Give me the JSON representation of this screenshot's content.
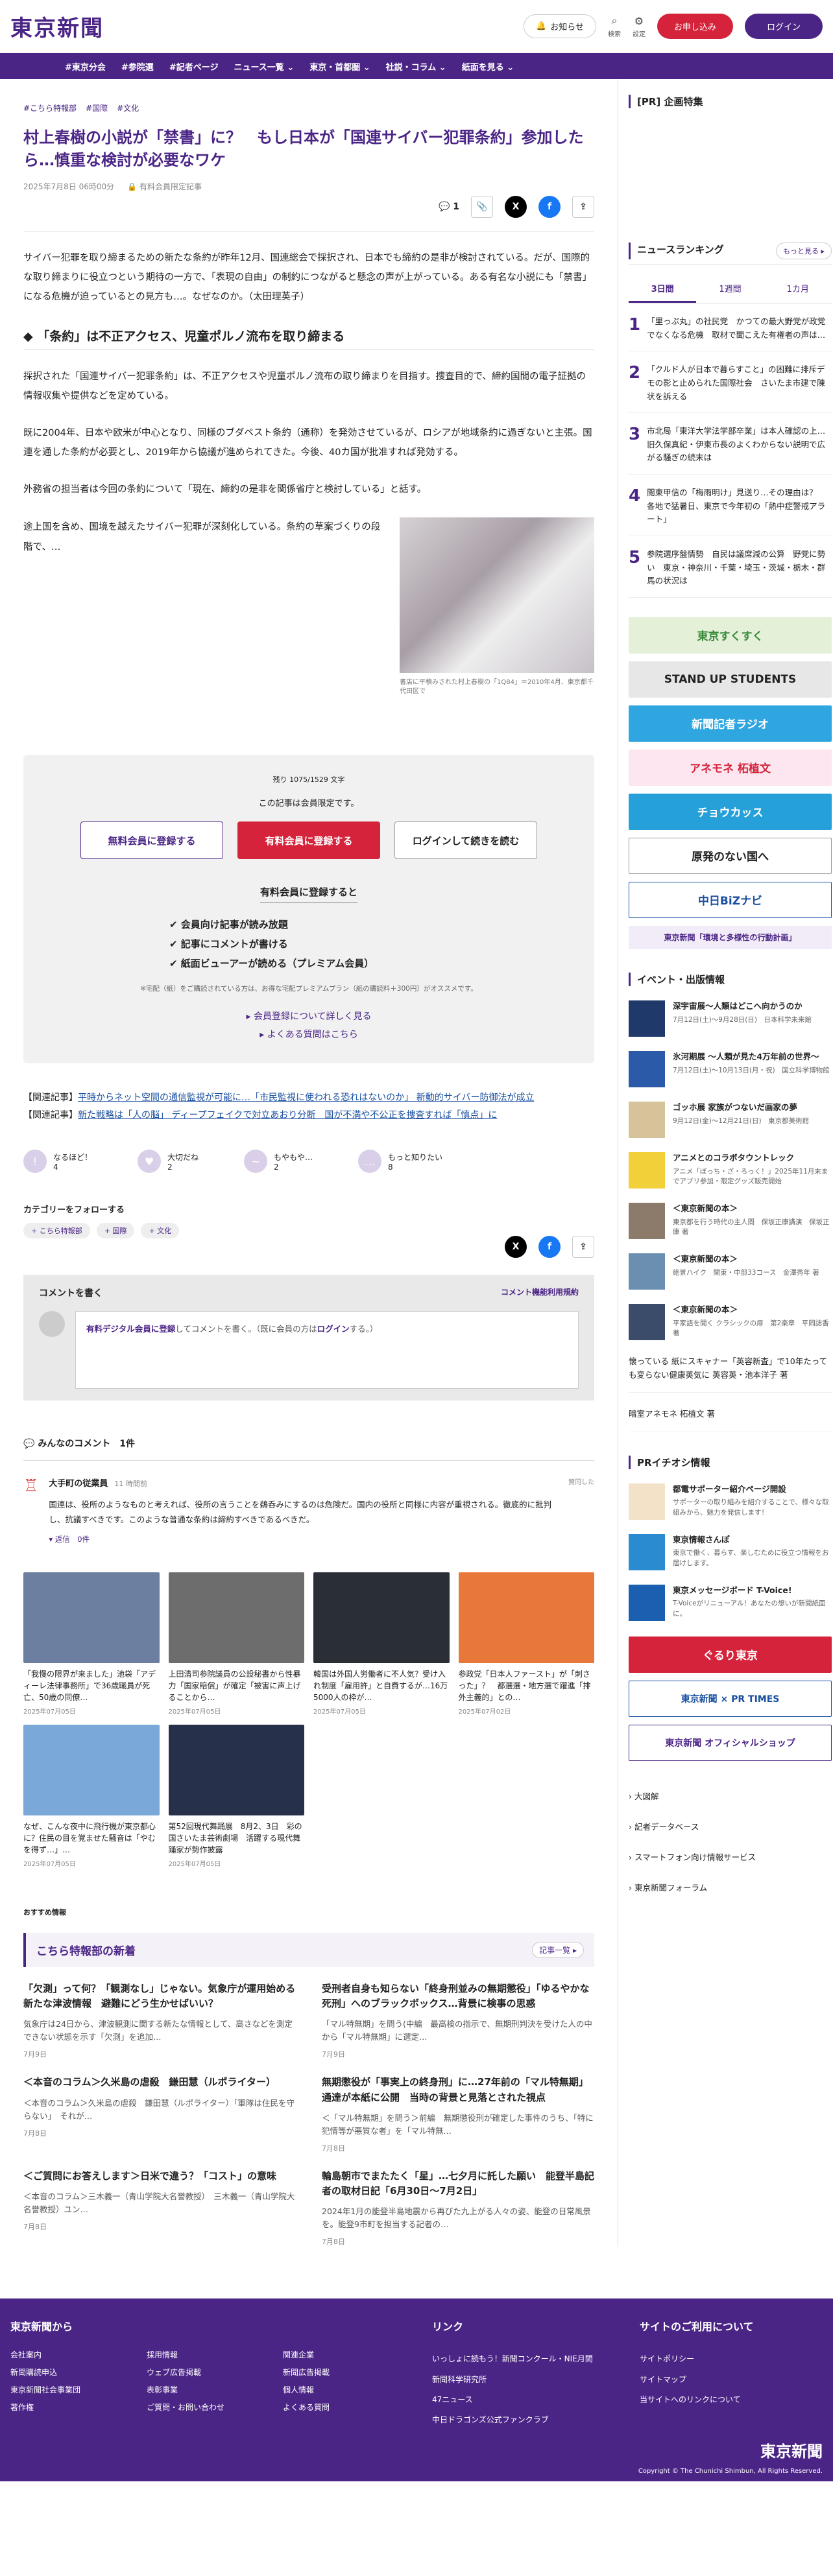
{
  "header": {
    "logo": "東京新聞",
    "notify": "お知らせ",
    "search": "検索",
    "settings": "設定",
    "signup": "お申し込み",
    "login": "ログイン"
  },
  "nav": [
    "#東京分会",
    "#参院選",
    "#記者ページ",
    "ニュース一覧 ⌄",
    "東京・首都圏 ⌄",
    "社説・コラム ⌄",
    "紙面を見る ⌄"
  ],
  "article": {
    "tags": [
      "#こちら特報部",
      "#国際",
      "#文化"
    ],
    "title": "村上春樹の小説が「禁書」に？　もし日本が「国連サイバー犯罪条約」参加したら…慎重な検討が必要なワケ",
    "date": "2025年7月8日 06時00分",
    "paid_label": "有料会員限定記事",
    "comments_count": "1",
    "lead": "サイバー犯罪を取り締まるための新たな条約が昨年12月、国連総会で採択され、日本でも締約の是非が検討されている。だが、国際的な取り締まりに役立つという期待の一方で、「表現の自由」の制約につながると懸念の声が上がっている。ある有名な小説にも「禁書」になる危機が迫っているとの見方も…。なぜなのか。（太田理英子）",
    "h2": "「条約」は不正アクセス、児童ポルノ流布を取り締まる",
    "p1": "採択された「国連サイバー犯罪条約」は、不正アクセスや児童ポルノ流布の取り締まりを目指す。捜査目的で、締約国間の電子証拠の情報収集や提供などを定めている。",
    "p2": "既に2004年、日本や欧米が中心となり、同様のブダペスト条約（通称）を発効させているが、ロシアが地域条約に過ぎないと主張。国連を通した条約が必要とし、2019年から協議が進められてきた。今後、40カ国が批准すれば発効する。",
    "p3": "外務省の担当者は今回の条約について「現在、締約の是非を関係省庁と検討している」と話す。",
    "p4": "途上国を含め、国境を越えたサイバー犯罪が深刻化している。条約の草案づくりの段階で、…",
    "caption": "書店に平積みされた村上春樹の「1Q84」＝2010年4月、東京都千代田区で"
  },
  "paywall": {
    "remain": "残り 1075/1529 文字",
    "limited": "この記事は会員限定です。",
    "btn_free": "無料会員に登録する",
    "btn_paid": "有料会員に登録する",
    "btn_login": "ログインして続きを読む",
    "benefit_title": "有料会員に登録すると",
    "benefits": [
      "✔ 会員向け記事が読み放題",
      "✔ 記事にコメントが書ける",
      "✔ 紙面ビューアーが読める（プレミアム会員）"
    ],
    "note": "※宅配（紙）をご購読されている方は、お得な宅配プレミアムプラン（紙の購読料＋300円）がオススメです。",
    "link1": "▸ 会員登録について詳しく見る",
    "link2": "▸ よくある質問はこちら"
  },
  "related": {
    "label": "【関連記事】",
    "r1": "平時からネット空間の通信監視が可能に…「市民監視に使われる恐れはないのか」 新動的サイバー防御法が成立",
    "r2": "新た戦略は「人の脳」 ディープフェイクで対立あおり分断　国が不満や不公正を捜査すれば「慎点」に"
  },
  "reactions": [
    {
      "label": "なるほど！",
      "count": "4"
    },
    {
      "label": "大切だね",
      "count": "2"
    },
    {
      "label": "もやもや…",
      "count": "2"
    },
    {
      "label": "もっと知りたい",
      "count": "8"
    }
  ],
  "follow": {
    "title": "カテゴリーをフォローする",
    "tags": [
      "+ こちら特報部",
      "+ 国際",
      "+ 文化"
    ]
  },
  "comment_box": {
    "title": "コメントを書く",
    "rules": "コメント機能利用規約",
    "text_a": "有料デジタル会員に登録",
    "text_b": "してコメントを書く。（既に会員の方は",
    "text_c": "ログイン",
    "text_d": "する。）"
  },
  "comments": {
    "title": "みんなのコメント　1件",
    "user": "大手町の従業員",
    "time": "11 時間前",
    "body": "国連は、役所のようなものと考えれば、役所の言うことを鵜呑みにするのは危険だ。国内の役所と同様に内容が重視される。徹底的に批判し、抗議すべきです。このような普通な条約は締約すべきであるべきだ。",
    "reply": "▾ 返信　0件",
    "like": "賛同した"
  },
  "cards": [
    {
      "t": "「我慢の限界が来ました」池袋「アディーレ法律事務所」で36歳職員が死亡、50歳の同僚…",
      "d": "2025年07月05日"
    },
    {
      "t": "上田清司参院議員の公設秘書から性暴力「国家賠償」が確定「被害に声上げることから…",
      "d": "2025年07月05日"
    },
    {
      "t": "韓国は外国人労働者に不人気？受け入れ制度「雇用許」と自費するが…16万5000人の枠が…",
      "d": "2025年07月05日"
    },
    {
      "t": "参政党「日本人ファースト」が「刺さった」？　都選選・地方選で躍進「排外主義的」との…",
      "d": "2025年07月02日"
    },
    {
      "t": "なぜ、こんな夜中に飛行機が東京都心に？住民の目を覚ませた騒音は「やむを得ず…」…",
      "d": "2025年07月05日"
    },
    {
      "t": "第52回現代舞踊展　8月2、3日　彩の国さいたま芸術劇場　活躍する現代舞踊家が勢作披露",
      "d": "2025年07月05日"
    }
  ],
  "recommend_label": "おすすめ情報",
  "more_news": {
    "title": "こちら特報部の新着",
    "more": "記事一覧 ▸",
    "items": [
      {
        "t": "「欠測」って何？「観測なし」じゃない。気象庁が運用始める新たな津波情報　避難にどう生かせばいい？",
        "b": "気象庁は24日から、津波観測に関する新たな情報として、高さなどを測定できない状態を示す「欠測」を追加…",
        "d": "7月9日"
      },
      {
        "t": "受刑者自身も知らない「終身刑並みの無期懲役」「ゆるやかな死刑」へのブラックボックス…背景に検事の思惑",
        "b": "「マル特無期」を問う(中編　最高検の指示で、無期刑判決を受けた人の中から「マル特無期」に選定…",
        "d": "7月9日"
      },
      {
        "t": "＜本音のコラム＞久米島の虐殺　鎌田慧（ルポライター）",
        "b": "＜本音のコラム＞久米島の虐殺　鎌田慧（ルポライター）「軍隊は住民を守らない」　それが…",
        "d": "7月8日"
      },
      {
        "t": "無期懲役が「事実上の終身刑」に…27年前の「マル特無期」通達が本紙に公開　当時の背景と見落とされた視点",
        "b": "＜「マル特無期」を問う＞前編　無期懲役刑が確定した事件のうち、「特に犯情等が悪質な者」を「マル特無…",
        "d": "7月8日"
      },
      {
        "t": "＜ご質問にお答えします＞日米で違う？「コスト」の意味",
        "b": "＜本音のコラム＞三木義一（青山学院大名誉教授）　三木義一（青山学院大名誉教授）ユン…",
        "d": "7月8日"
      },
      {
        "t": "輪島朝市でまたたく「星」…七夕月に託した願い　能登半島記者の取材日記「6月30日〜7月2日」",
        "b": "2024年1月の能登半島地震から再びた九上がる人々の姿、能登の日常風景を。能登9市町を担当する記者の…",
        "d": "7月8日"
      }
    ]
  },
  "sidebar": {
    "pr_title": "[PR] 企画特集",
    "ranking_title": "ニュースランキング",
    "ranking_more": "もっと見る ▸",
    "tabs": [
      "3日間",
      "1週間",
      "1カ月"
    ],
    "ranking": [
      {
        "n": "1",
        "t": "「里っぷ丸」の社民党　かつての最大野党が政党でなくなる危機　取材で聞こえた有権者の声は…"
      },
      {
        "n": "2",
        "t": "「クルド人が日本で暮らすこと」の困難に排斥デモの影と止められた国際社会　さいたま市建で陳状を訴える"
      },
      {
        "n": "3",
        "t": "市北局「東洋大学法学部卒業」は本人確認の上…旧久保真紀・伊東市長のよくわからない説明で広がる騒ぎの続末は"
      },
      {
        "n": "4",
        "t": "閲東甲信の「梅雨明け」見送り…その理由は？　各地で猛暑日、東京で今年初の「熱中症警戒アラート」"
      },
      {
        "n": "5",
        "t": "参院選序盤情勢　自民は議席減の公算　野党に勢い　東京・神奈川・千葉・埼玉・茨城・栃木・群馬の状況は"
      }
    ],
    "banners": [
      "東京すくすく",
      "STAND UP STUDENTS",
      "新聞記者ラジオ",
      "アネモネ 柘植文",
      "チョウカッス",
      "原発のない国へ",
      "中日BiZナビ",
      "東京新聞「環境と多様性の行動計画」"
    ],
    "events_title": "イベント・出版情報",
    "events": [
      {
        "t": "深宇宙展〜人類はどこへ向かうのか",
        "s": "7月12日(土)〜9月28日(日)　日本科学未来館"
      },
      {
        "t": "氷河期展 〜人類が見た4万年前の世界〜",
        "s": "7月12日(土)〜10月13日(月・祝)　国立科学博物館"
      },
      {
        "t": "ゴッホ展 家族がつないだ画家の夢",
        "s": "9月12日(金)〜12月21日(日)　東京都美術館"
      },
      {
        "t": "アニメとのコラボタウントレック",
        "s": "アニメ「ぼっち・ざ・ろっく！」2025年11月末までアプリ参加・限定グッズ販売開始"
      },
      {
        "t": "＜東京新聞の本＞",
        "s": "東京都を行う時代の主人間　保坂正康講演　保坂正康 著"
      },
      {
        "t": "＜東京新聞の本＞",
        "s": "絶景ハイク　関東・中部33コース　金澤秀年 著"
      },
      {
        "t": "＜東京新聞の本＞",
        "s": "平家語を聞く クラシックの扉　第2楽章　平岡誌香 著"
      }
    ],
    "links": [
      "懐っている 紙にスキャナー「英容新査」で10年たっても変らない健康英気に 英容英・池本洋子 著",
      "暗室アネモネ 柘植文 著"
    ],
    "pr_iseon": "PRイチオシ情報",
    "pr_items": [
      {
        "t": "都電サポーター紹介ページ開設",
        "s": "サポーターの取り組みを紹介することで、様々な取組みから、魅力を発信します！"
      },
      {
        "t": "東京情報さんぽ",
        "s": "東京で働く、暮らす、楽しむために役立つ情報をお届けします。"
      },
      {
        "t": "東京メッセージボード T-Voice!",
        "s": "T-Voiceがリニューアル！あなたの想いが新聞紙面に。"
      }
    ],
    "bottom_banners": [
      "ぐるり東京",
      "東京新聞 × PR TIMES",
      "東京新聞 オフィシャルショップ"
    ],
    "menu": [
      "› 大図解",
      "› 記者データベース",
      "› スマートフォン向け情報サービス",
      "› 東京新聞フォーラム"
    ]
  },
  "footer": {
    "col1_title": "東京新聞から",
    "col1": [
      "会社案内",
      "採用情報",
      "関連企業",
      "新聞購読申込",
      "ウェブ広告掲載",
      "新聞広告掲載",
      "東京新聞社会事業団",
      "表彰事業",
      "個人情報",
      "著作権",
      "ご質問・お問い合わせ",
      "よくある質問"
    ],
    "col2_title": "リンク",
    "col2": [
      "いっしょに読もう！新聞コンクール・NIE月間",
      "新聞科学研究所",
      "47ニュース",
      "中日ドラゴンズ公式ファンクラブ"
    ],
    "col3_title": "サイトのご利用について",
    "col3": [
      "サイトポリシー",
      "サイトマップ",
      "当サイトへのリンクについて"
    ],
    "logo": "東京新聞",
    "copyright": "Copyright © The Chunichi Shimbun, All Rights Reserved."
  }
}
